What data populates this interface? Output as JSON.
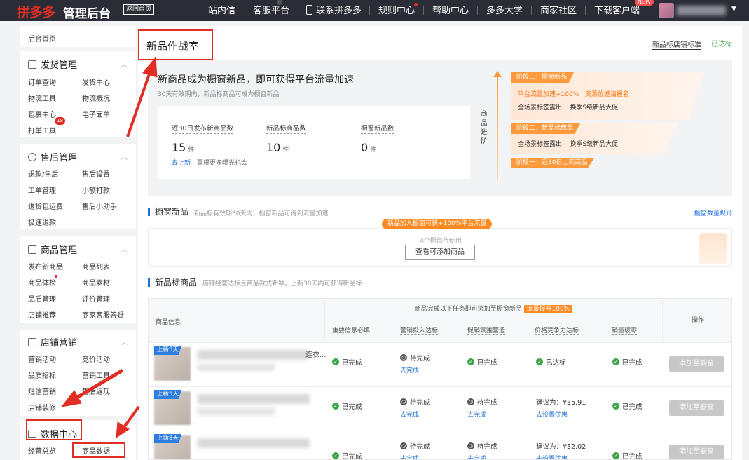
{
  "topbar": {
    "logo": "拼多多",
    "title": "管理后台",
    "back_home": "返回首页",
    "nav": [
      "站内信",
      "客服平台",
      "联系拼多多",
      "规则中心",
      "帮助中心",
      "多多大学",
      "商家社区",
      "下载客户端"
    ],
    "new_badge": "NEW"
  },
  "sidebar": {
    "home": "后台首页",
    "sections": [
      {
        "title": "发货管理",
        "links": [
          "订单查询",
          "发货中心",
          "物流工具",
          "物流概况",
          "包裹中心",
          "电子面单",
          "打单工具"
        ],
        "badge": "18"
      },
      {
        "title": "售后管理",
        "links": [
          "退款/售后",
          "售后设置",
          "工单管理",
          "小额打款",
          "退货包运费",
          "售后小助手",
          "极速退款"
        ]
      },
      {
        "title": "商品管理",
        "links": [
          "发布新商品",
          "商品列表",
          "商品体检",
          "商品素材",
          "品质管理",
          "评价管理",
          "店铺推荐",
          "商家客服答疑"
        ]
      },
      {
        "title": "店铺营销",
        "links": [
          "营销活动",
          "竞价活动",
          "品质招标",
          "营销工具",
          "短信营销",
          "售后返现",
          "店铺装修"
        ]
      },
      {
        "title": "数据中心",
        "links": [
          "经营总览",
          "商品数据"
        ]
      }
    ]
  },
  "main": {
    "page_title": "新品作战室",
    "std_link": "新品标店铺标准",
    "std_status": "已达标",
    "hero": {
      "headline": "新商品成为橱窗新品，即可获得平台流量加速",
      "sub": "30天有效期内，新品标商品可成为橱窗新品",
      "stats": [
        {
          "label": "近30日发布新商品数",
          "value": "15",
          "unit": "件"
        },
        {
          "label": "新品标商品数",
          "value": "10",
          "unit": "件"
        },
        {
          "label": "橱窗新品数",
          "value": "0",
          "unit": "件"
        }
      ],
      "publish_link": "去上新",
      "publish_text": "赢得更多曝光机会",
      "step_label": "商品进阶",
      "stages": [
        {
          "tag": "阶段三：橱窗新品",
          "line1a": "平台流量加速+100%",
          "line1b": "资源位邀请报名",
          "line2": "全场景标签露出    换季S级新品大促"
        },
        {
          "tag": "阶段二：新品标商品",
          "line2": "全场景标签露出    换季S级新品大促"
        },
        {
          "tag": "阶段一：近30日上新商品"
        }
      ]
    },
    "window": {
      "title": "橱窗新品",
      "sub": "新品标有效期30天内，橱窗新品可得到流量加速",
      "rule_link": "橱窗数量规则",
      "promo": "新品加入橱窗可获+100%平台流量",
      "remaining": "4个橱窗待使用",
      "button": "查看可添加商品"
    },
    "newlabel": {
      "title": "新品标商品",
      "sub": "店铺经营达标且商品款式新颖，上新30天内可获得新品标"
    },
    "table": {
      "col_product": "商品信息",
      "group_header": "商品完成以下任务即可添加至橱窗新品",
      "group_badge": "流量提升100%",
      "col_action": "操作",
      "subcols": [
        "重要信息必填",
        "营销投入达标",
        "促销氛围营造",
        "价格竞争力达标",
        "销量破零"
      ],
      "rows": [
        {
          "tag": "上新3天",
          "title_tail": "连衣...",
          "c1": "已完成",
          "c2": "待完成",
          "c2_link": "去完成",
          "c3": "已完成",
          "c4": "已达标",
          "c5": "已完成",
          "action": "添加至橱窗"
        },
        {
          "tag": "上新5天",
          "title_tail": "",
          "c1": "已完成",
          "c2": "待完成",
          "c2_link": "去完成",
          "c3": "待完成",
          "c3_link": "去完成",
          "c4": "建议为：¥35.91",
          "c4_link": "去设置优惠",
          "c5": "已完成",
          "action": "添加至橱窗"
        },
        {
          "tag": "上新8天",
          "title_tail": "",
          "c1": "已完成",
          "c2": "待完成",
          "c2_link": "去完成",
          "c3": "待完成",
          "c3_link": "去完成",
          "c4": "建议为：¥32.02",
          "c4_link": "去设置优惠",
          "c5": "已完成",
          "action": "添加至橱窗"
        }
      ]
    }
  },
  "colors": {
    "accent": "#e02e24",
    "blue": "#1e6fd9",
    "orange": "#ff8a24",
    "green": "#3aa546",
    "topbar": "#2b2d36"
  }
}
